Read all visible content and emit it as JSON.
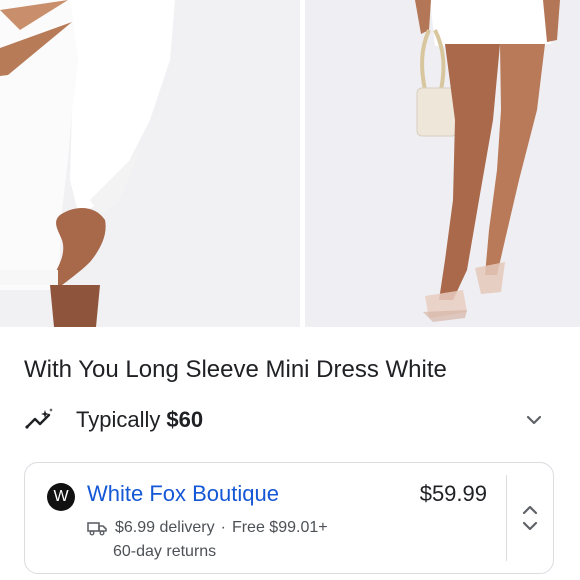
{
  "product": {
    "title": "With You Long Sleeve Mini Dress White",
    "gallery": {
      "images": [
        "dress-closeup-image",
        "dress-full-legs-image"
      ]
    }
  },
  "price_summary": {
    "label": "Typically",
    "price": "$60",
    "icon": "price-trend-icon",
    "expand_icon": "chevron-down-icon"
  },
  "seller": {
    "logo_letter": "W",
    "name": "White Fox Boutique",
    "price": "$59.99",
    "delivery": "$6.99 delivery",
    "separator": "·",
    "free_shipping": "Free $99.01+",
    "returns": "60-day returns",
    "truck_icon": "truck-icon",
    "toggle_icon": "expand-collapse-icon"
  },
  "colors": {
    "link": "#1558d6",
    "text_primary": "#202124",
    "text_secondary": "#4d5156",
    "border": "#dadce0"
  }
}
